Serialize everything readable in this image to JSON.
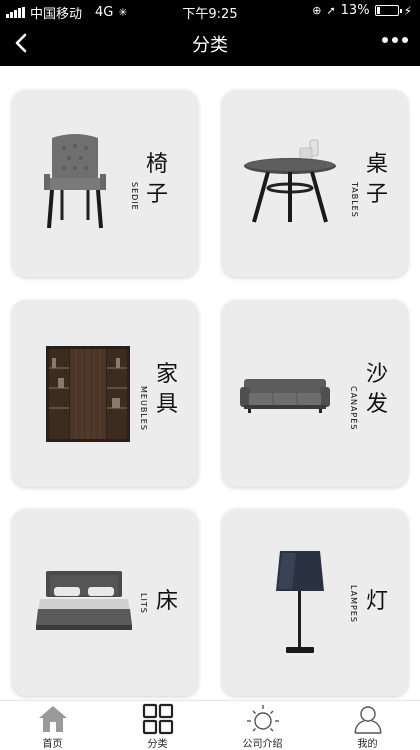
{
  "status_bar": {
    "carrier": "中国移动",
    "network": "4G",
    "time": "下午9:25",
    "battery_percent": "13%",
    "battery_level": 0.13
  },
  "header": {
    "title": "分类"
  },
  "categories": [
    {
      "cn": "椅子",
      "en": "SEDIE"
    },
    {
      "cn": "桌子",
      "en": "TABLES"
    },
    {
      "cn": "家具",
      "en": "MEUBLES"
    },
    {
      "cn": "沙发",
      "en": "CANAPÉS"
    },
    {
      "cn": "床",
      "en": "LITS"
    },
    {
      "cn": "灯",
      "en": "LAMPES"
    }
  ],
  "tabs": [
    {
      "label": "首页",
      "icon": "home-icon"
    },
    {
      "label": "分类",
      "icon": "grid-icon",
      "active": true
    },
    {
      "label": "公司介绍",
      "icon": "sun-icon"
    },
    {
      "label": "我的",
      "icon": "user-icon"
    }
  ]
}
